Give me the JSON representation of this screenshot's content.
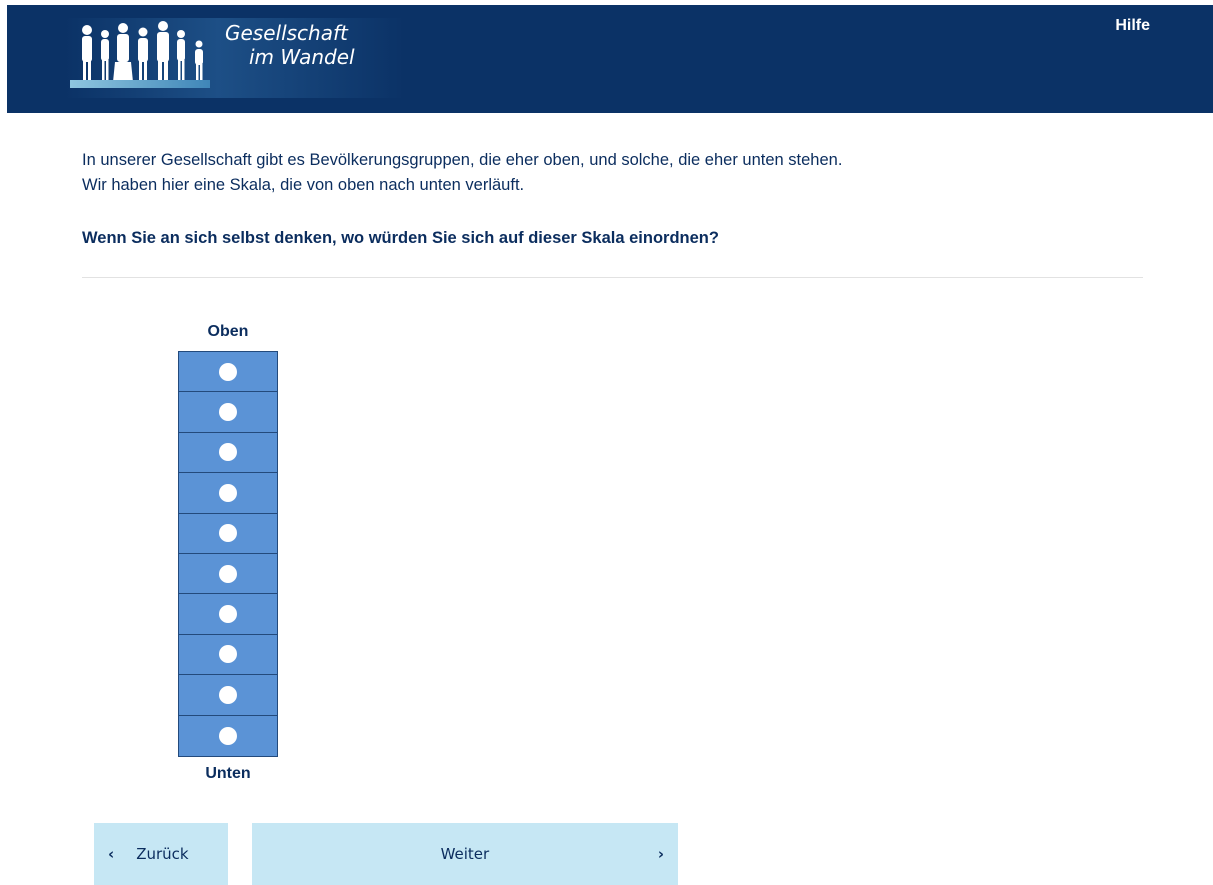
{
  "header": {
    "logo_line1": "Gesellschaft",
    "logo_line2": "im Wandel",
    "help_label": "Hilfe"
  },
  "intro": {
    "line1": "In unserer Gesellschaft gibt es Bevölkerungsgruppen, die eher oben, und solche, die eher unten stehen.",
    "line2": "Wir haben hier eine Skala, die von oben nach unten verläuft."
  },
  "question": "Wenn Sie an sich selbst denken, wo würden Sie sich auf dieser Skala einordnen?",
  "scale": {
    "top_label": "Oben",
    "bottom_label": "Unten",
    "option_count": 10,
    "selected": null,
    "cell_color": "#5b93d6"
  },
  "nav": {
    "back_label": "Zurück",
    "next_label": "Weiter",
    "back_icon": "chevron-left-icon",
    "next_icon": "chevron-right-icon",
    "button_color": "#c6e7f4"
  },
  "colors": {
    "header_bg": "#0b3266",
    "text": "#0b2d5e"
  }
}
